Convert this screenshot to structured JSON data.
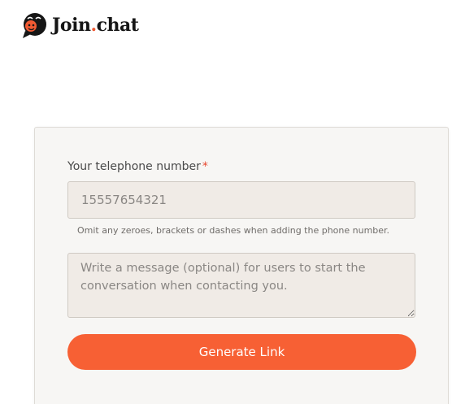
{
  "header": {
    "logo_word": "Join",
    "logo_dot": ".",
    "logo_suffix": "chat",
    "brand_color": "#f05a33",
    "logo_icon": "speech-bubble-face-icon"
  },
  "form": {
    "phone_label": "Your telephone number",
    "required_mark": "*",
    "phone_placeholder": "15557654321",
    "phone_value": "",
    "phone_hint": "Omit any zeroes, brackets or dashes when adding the phone number.",
    "message_placeholder": "Write a message (optional) for users to start the conversation when contacting you.",
    "message_value": "",
    "generate_label": "Generate Link",
    "button_color": "#f76034"
  }
}
